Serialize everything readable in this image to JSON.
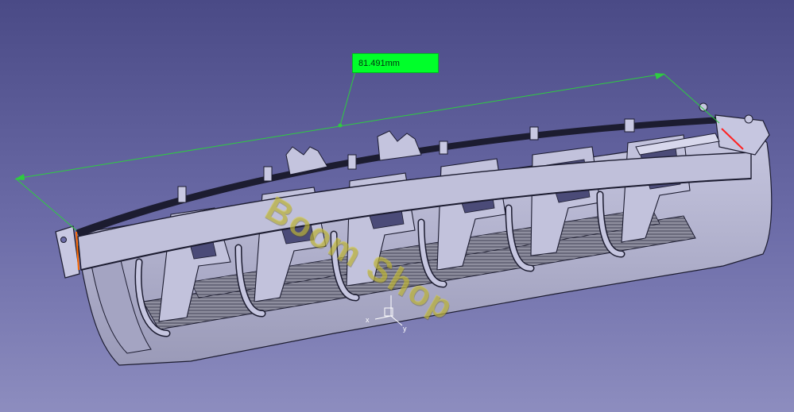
{
  "viewport": {
    "background_top": "#4a4a86",
    "background_bottom": "#8d8dbf"
  },
  "model": {
    "part_color": "#bcbcd8",
    "edge_color": "#1c1c30"
  },
  "measurement": {
    "value_label": "81.491mm",
    "label_color": "#00ff2a",
    "line_color": "#2ecc40"
  },
  "watermark": {
    "text": "Boom Shop"
  },
  "axis_triad": {
    "x_label": "x",
    "y_label": "y"
  }
}
